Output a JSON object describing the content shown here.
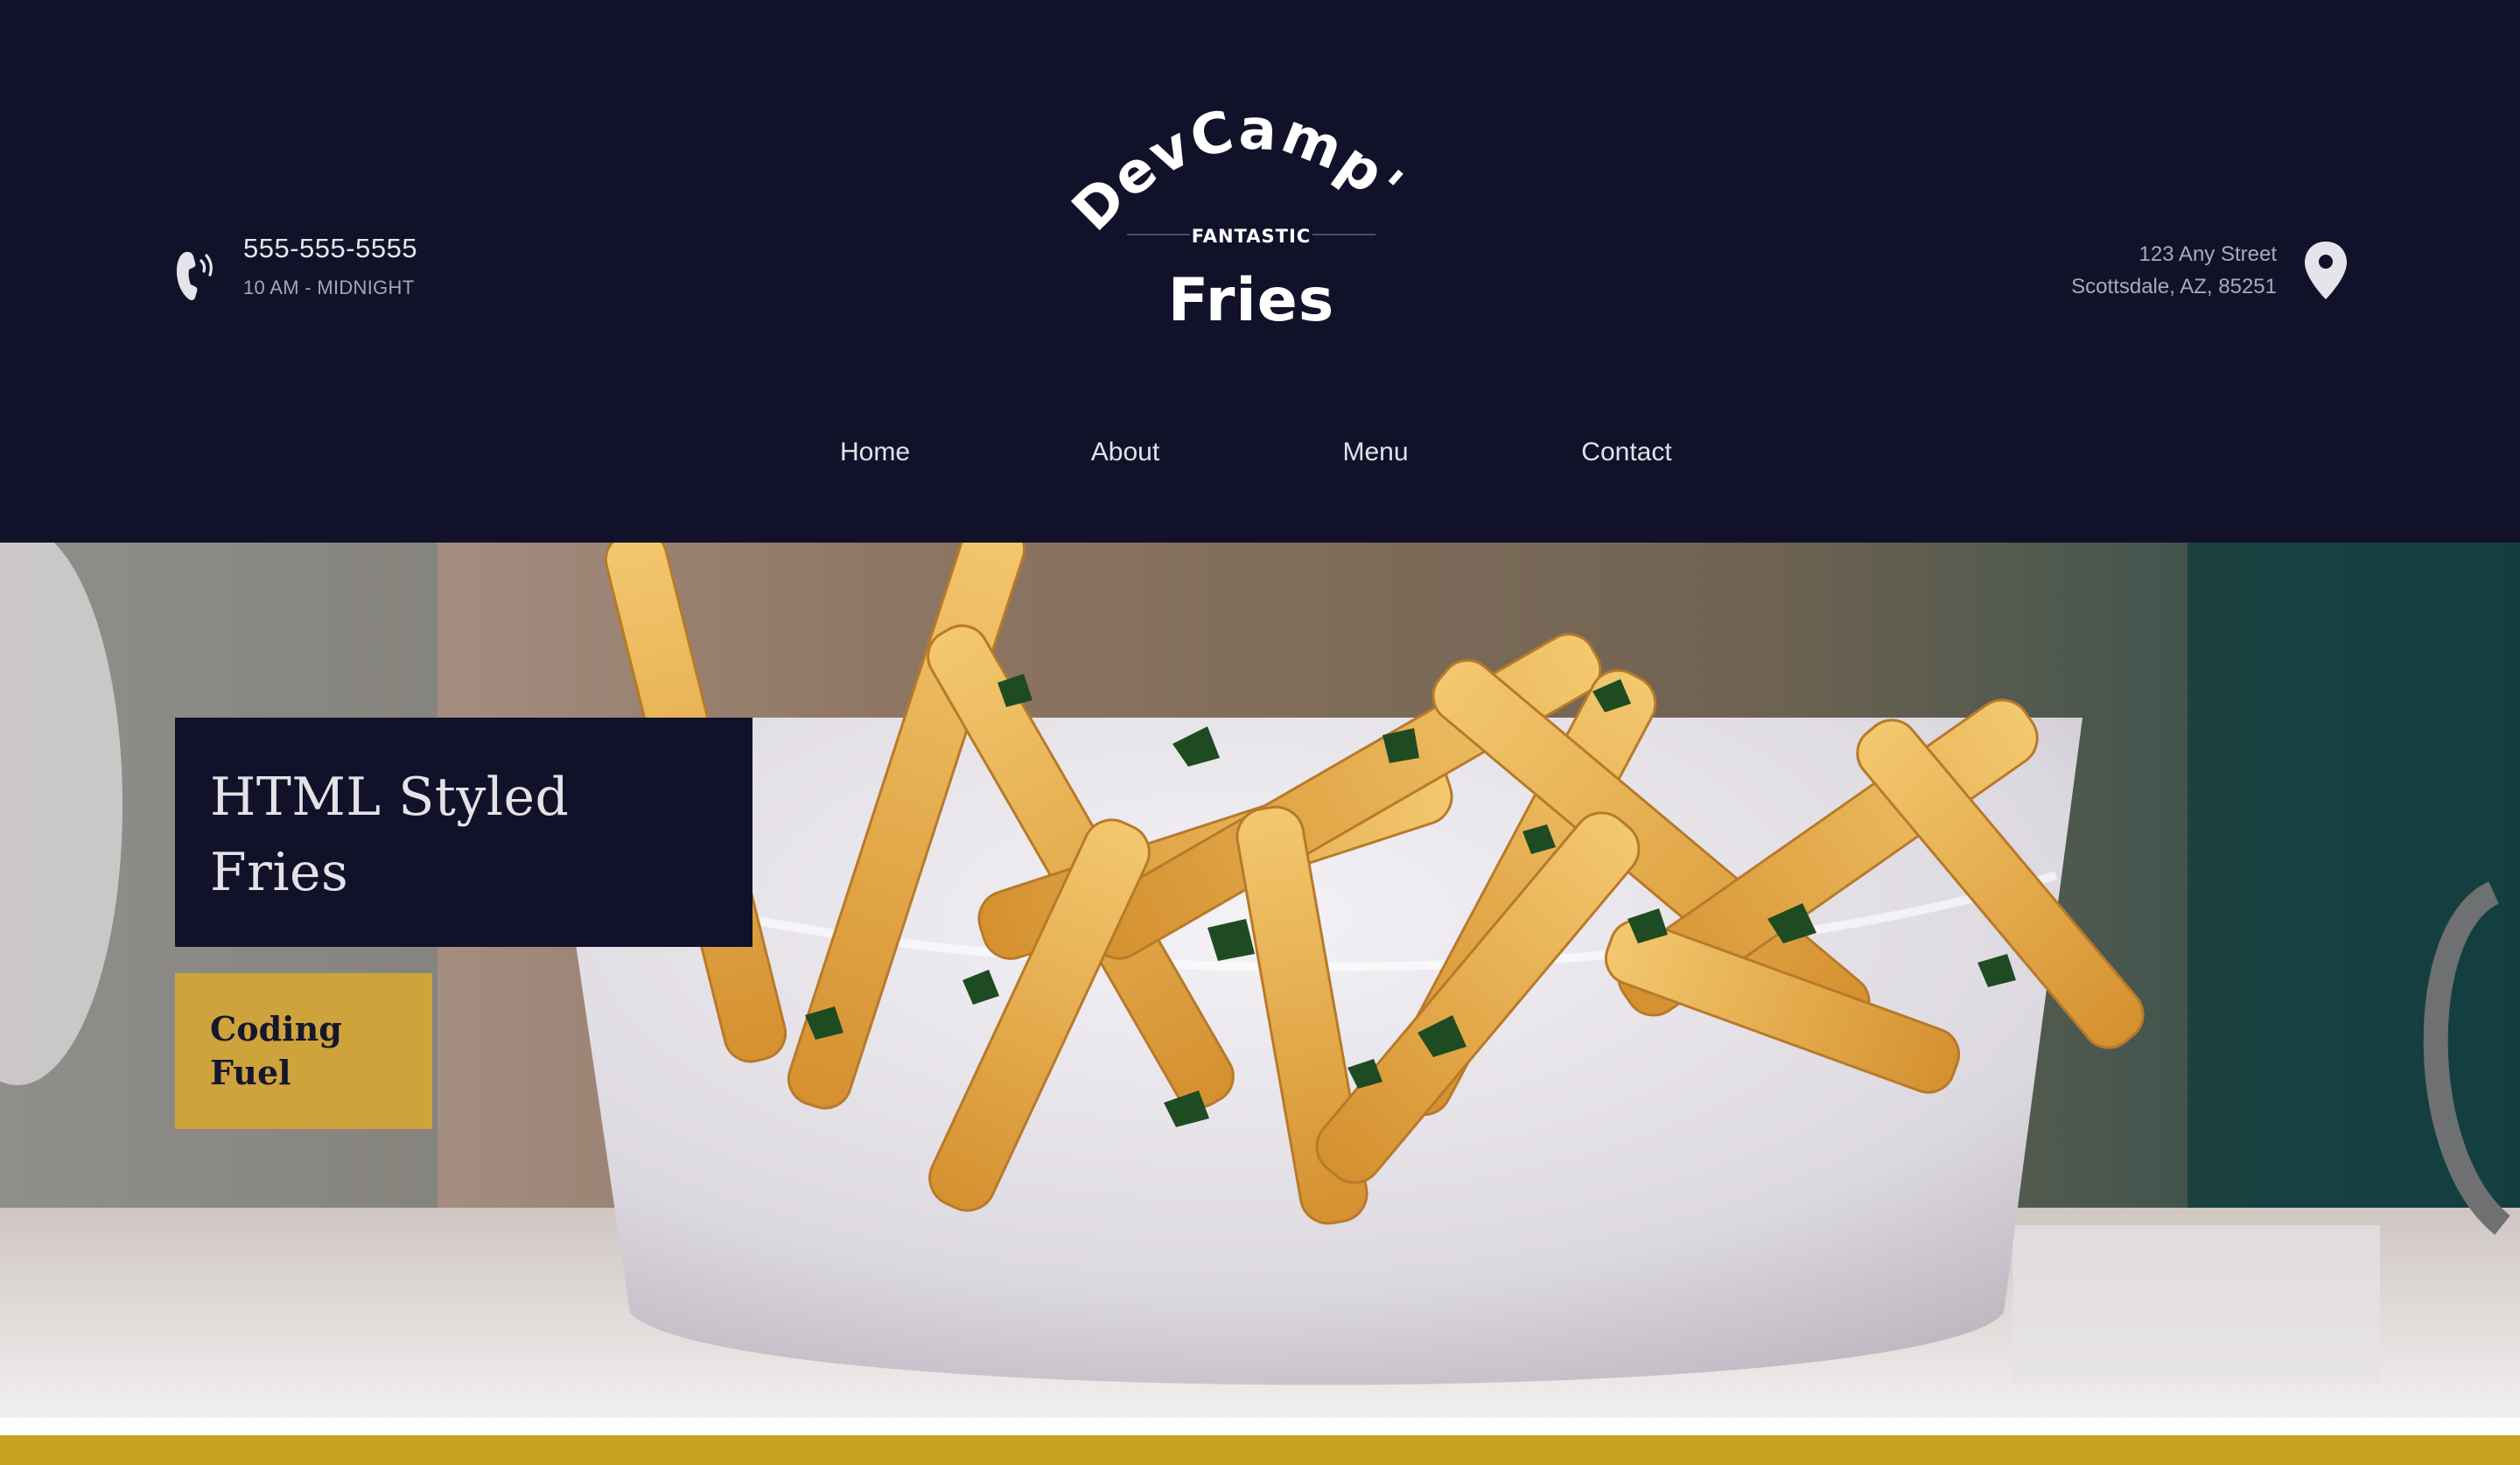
{
  "header": {
    "phone": {
      "number": "555-555-5555",
      "hours": "10 AM - MIDNIGHT",
      "icon": "phone-icon"
    },
    "logo": {
      "brand": "DevCamp's",
      "tagline": "FANTASTIC",
      "product": "Fries"
    },
    "address": {
      "line1": "123 Any Street",
      "line2": "Scottsdale, AZ, 85251",
      "icon": "map-pin-icon"
    },
    "nav": {
      "items": [
        {
          "label": "Home"
        },
        {
          "label": "About"
        },
        {
          "label": "Menu"
        },
        {
          "label": "Contact"
        }
      ]
    }
  },
  "hero": {
    "title": "HTML Styled Fries",
    "button_label": "Coding Fuel"
  },
  "colors": {
    "background": "#11122a",
    "accent": "#cea33c",
    "footer_strip": "#c9a222"
  }
}
